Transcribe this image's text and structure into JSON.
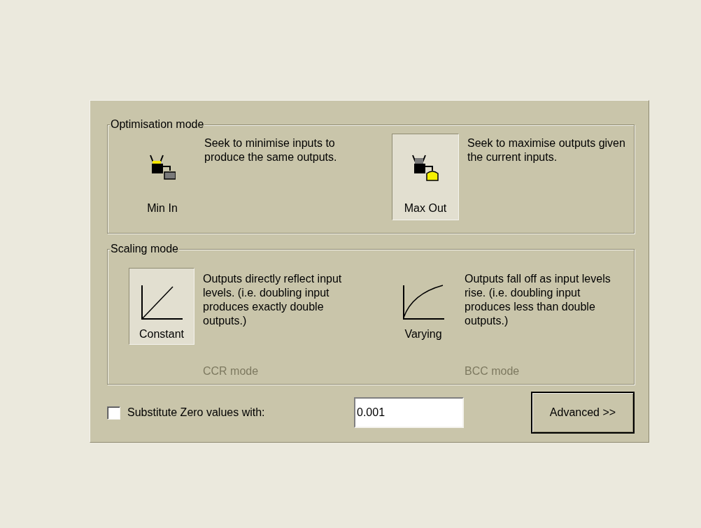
{
  "groups": [
    {
      "title": "Optimisation mode",
      "options": [
        {
          "kind": "min_in",
          "label": "Min In",
          "description": "Seek to minimise inputs to produce the same outputs.",
          "selected": false
        },
        {
          "kind": "max_out",
          "label": "Max Out",
          "description": "Seek to maximise outputs given the current inputs.",
          "selected": true
        }
      ]
    },
    {
      "title": "Scaling mode",
      "options": [
        {
          "kind": "linear",
          "label": "Constant",
          "description": "Outputs directly reflect input levels. (i.e. doubling input produces exactly double outputs.)",
          "selected": true,
          "mode_label": "CCR mode",
          "mode_disabled": true
        },
        {
          "kind": "curve",
          "label": "Varying",
          "description": "Outputs fall off as input levels rise. (i.e. doubling input produces less than double outputs.)",
          "selected": false,
          "mode_label": "BCC mode",
          "mode_disabled": true
        }
      ]
    }
  ],
  "substitute": {
    "label": "Substitute Zero values with:",
    "checked": false,
    "value": "0.001"
  },
  "advanced_button": "Advanced >>"
}
